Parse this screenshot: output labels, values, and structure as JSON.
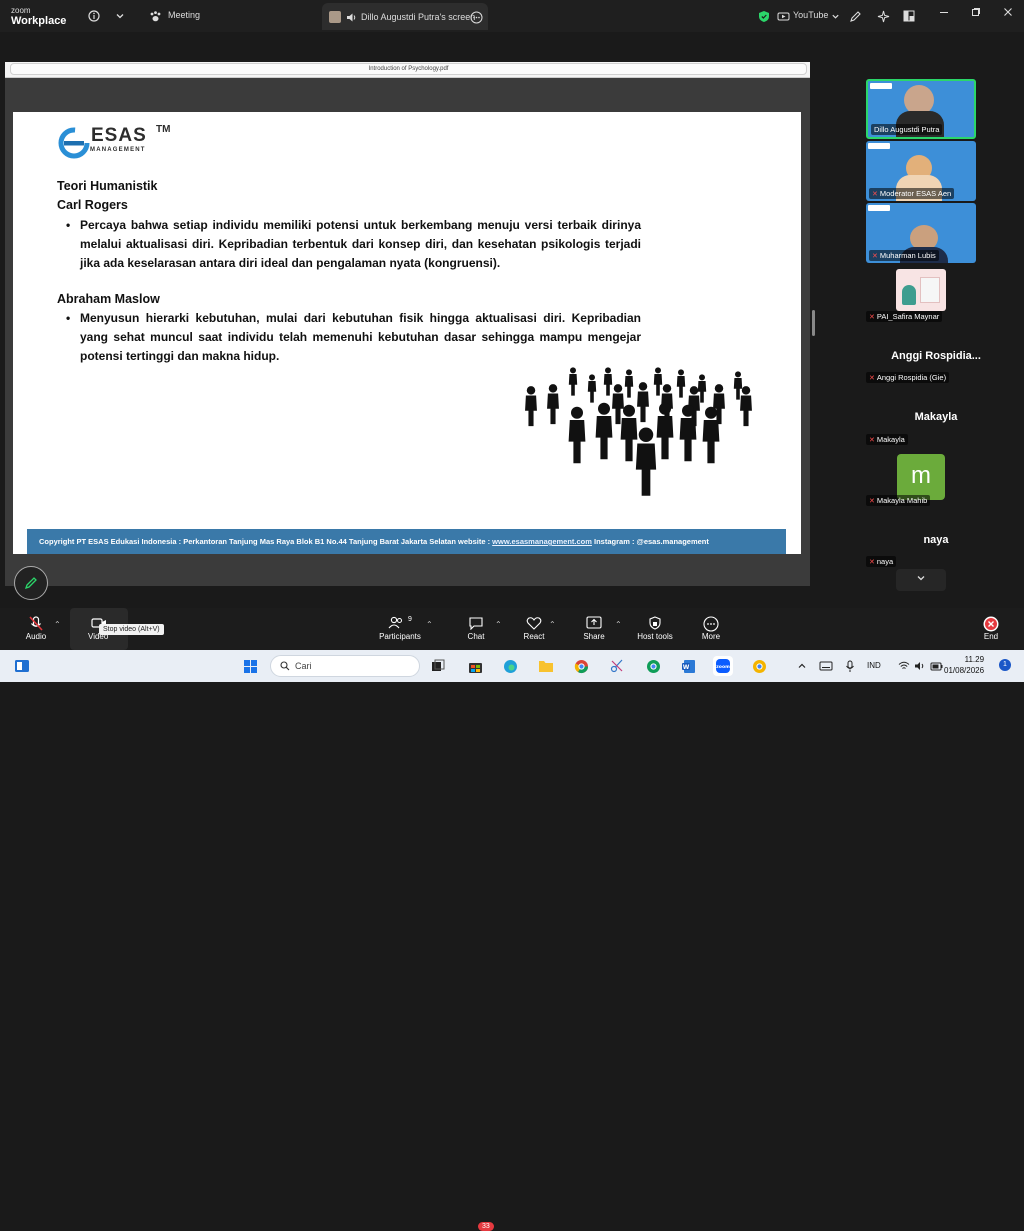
{
  "titlebar": {
    "brand_top": "zoom",
    "brand_bottom": "Workplace",
    "meeting_label": "Meeting",
    "share_tab_label": "Dillo Augustdi Putra's screen",
    "youtube_label": "YouTube"
  },
  "pdf": {
    "filename": "Introduction of Psychology.pdf"
  },
  "slide": {
    "logo_text": "ESAS",
    "logo_sub": "MANAGEMENT",
    "logo_tm": "TM",
    "heading1": "Teori Humanistik",
    "heading2": "Carl Rogers",
    "bullet1": "Percaya bahwa setiap individu memiliki potensi untuk berkembang menuju versi terbaik dirinya melalui aktualisasi diri. Kepribadian terbentuk dari konsep diri, dan kesehatan psikologis terjadi jika ada keselarasan antara diri ideal dan pengalaman nyata (kongruensi).",
    "heading3": "Abraham Maslow",
    "bullet2": "Menyusun hierarki kebutuhan, mulai dari kebutuhan fisik hingga aktualisasi diri. Kepribadian yang sehat muncul saat individu telah memenuhi kebutuhan dasar sehingga mampu mengejar potensi tertinggi dan makna hidup.",
    "footer_text": "Copyright PT ESAS Edukasi Indonesia : Perkantoran Tanjung Mas Raya Blok B1 No.44 Tanjung Barat Jakarta Selatan website : ",
    "footer_link": "www.esasmanagement.com",
    "footer_instagram": " Instagram : @esas.management"
  },
  "participants_panel": {
    "tile1": "Dillo Augustdi Putra",
    "tile2": "Moderator ESAS Aen",
    "tile3": "Muharman Lubis",
    "tile4": "PAI_Safira Maynar",
    "big5": "Anggi Rospidia...",
    "tile5": "Anggi Rospidia (Gie)",
    "big6": "Makayla",
    "tile6": "Makayla",
    "avatar7": "m",
    "tile7": "Makayla Mahib",
    "big8": "naya",
    "tile8": "naya"
  },
  "toolbar": {
    "audio": "Audio",
    "video": "Video",
    "video_tooltip": "Stop video (Alt+V)",
    "participants": "Participants",
    "participants_count": "9",
    "chat": "Chat",
    "chat_badge": "33",
    "react": "React",
    "share": "Share",
    "host_tools": "Host tools",
    "more": "More",
    "end": "End"
  },
  "taskbar": {
    "search_placeholder": "Cari",
    "language": "IND",
    "time": "11.29",
    "date": "01/08/2026",
    "notification_count": "1"
  },
  "colors": {
    "footer_bar": "#3a79a9",
    "active_speaker_border": "#2bd66a",
    "end_button": "#e5393f",
    "avatar_green": "#6bab3b"
  }
}
